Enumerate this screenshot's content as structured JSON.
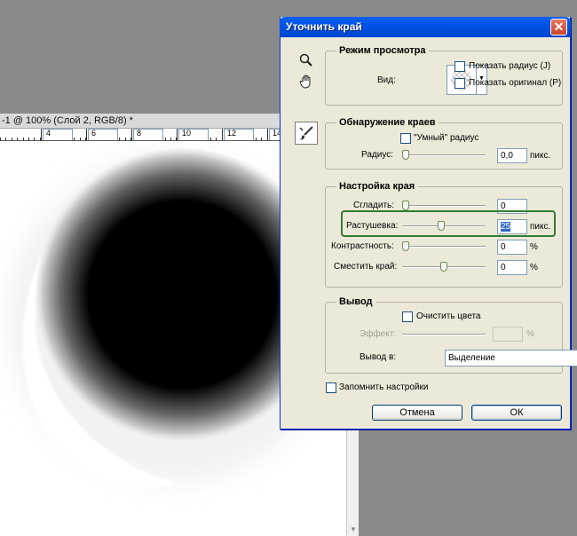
{
  "document": {
    "tab_title": "-1 @ 100% (Слой 2, RGB/8) *",
    "ruler_labels": [
      "4",
      "6",
      "8",
      "10",
      "12",
      "14"
    ]
  },
  "dialog": {
    "title": "Уточнить край",
    "close_glyph": "✕",
    "tools": [
      "zoom-icon",
      "hand-icon",
      "brush-icon"
    ],
    "view_mode": {
      "heading": "Режим просмотра",
      "view_label": "Вид:",
      "show_radius_label": "Показать радиус (J)",
      "show_radius_checked": false,
      "show_original_label": "Показать оригинал (P)",
      "show_original_checked": false
    },
    "edge_detection": {
      "heading": "Обнаружение краев",
      "smart_radius_label": "\"Умный\" радиус",
      "smart_radius_checked": false,
      "radius_label": "Радиус:",
      "radius_value": "0,0",
      "radius_unit": "пикс.",
      "radius_level": 0
    },
    "adjust_edge": {
      "heading": "Настройка края",
      "smooth_label": "Сгладить:",
      "smooth_value": "0",
      "smooth_level": 0,
      "feather_label": "Растушевка:",
      "feather_value": "25",
      "feather_unit": "пикс.",
      "feather_level": 0.47,
      "contrast_label": "Контрастность:",
      "contrast_value": "0",
      "contrast_unit": "%",
      "contrast_level": 0,
      "shift_label": "Сместить край:",
      "shift_value": "0",
      "shift_unit": "%",
      "shift_level": 0.5
    },
    "output": {
      "heading": "Вывод",
      "decontaminate_label": "Очистить цвета",
      "decontaminate_checked": false,
      "amount_label": "Эффект:",
      "amount_value": "",
      "amount_unit": "%",
      "output_to_label": "Вывод в:",
      "output_to_value": "Выделение"
    },
    "remember_label": "Запомнить настройки",
    "remember_checked": false,
    "cancel_label": "Отмена",
    "ok_label": "ОК"
  },
  "colors": {
    "titlebar": "#0053e6",
    "highlight": "#2e7d32",
    "dialog_bg": "#ece9d8"
  }
}
